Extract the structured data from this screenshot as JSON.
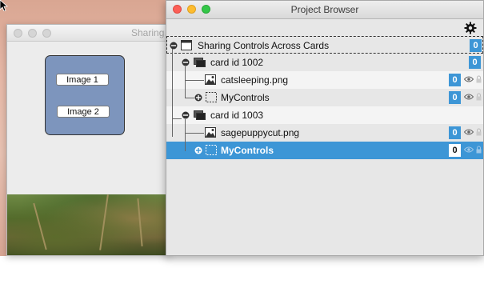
{
  "stack_window": {
    "title": "Sharing",
    "buttons": [
      "Image 1",
      "Image 2"
    ]
  },
  "project_browser": {
    "title": "Project Browser",
    "rows": [
      {
        "label": "Sharing Controls Across Cards",
        "count": "0",
        "kind": "stack"
      },
      {
        "label": "card id 1002",
        "count": "0",
        "kind": "card"
      },
      {
        "label": "catsleeping.png",
        "count": "0",
        "kind": "image"
      },
      {
        "label": "MyControls",
        "count": "0",
        "kind": "group"
      },
      {
        "label": "card id 1003",
        "count": "",
        "kind": "card"
      },
      {
        "label": "sagepuppycut.png",
        "count": "0",
        "kind": "image"
      },
      {
        "label": "MyControls",
        "count": "0",
        "kind": "group",
        "selected": true
      }
    ]
  },
  "colors": {
    "selection": "#3d96d6",
    "badge": "#3d96d6",
    "group_panel": "#7d95bd"
  }
}
